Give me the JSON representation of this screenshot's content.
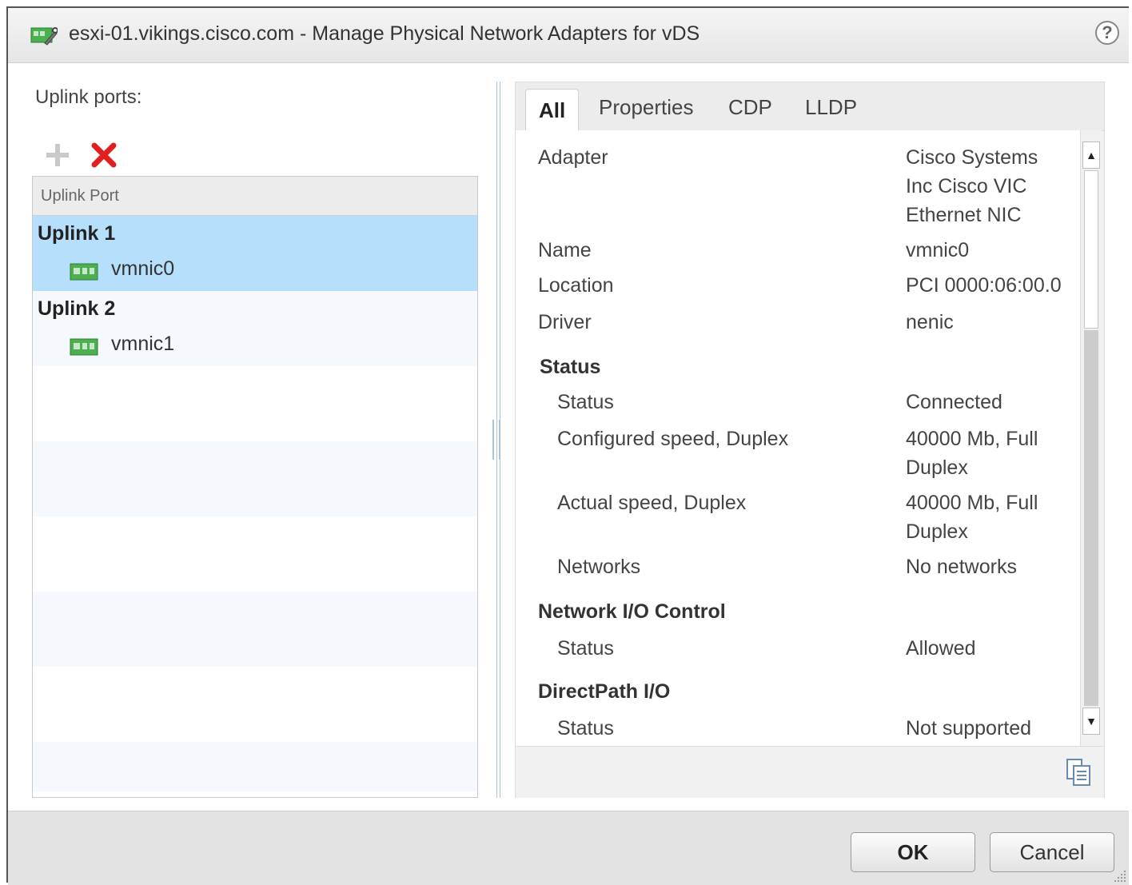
{
  "window": {
    "title": "esxi-01.vikings.cisco.com - Manage Physical Network Adapters for vDS",
    "help_label": "?"
  },
  "uplinks": {
    "label": "Uplink ports:",
    "column_header": "Uplink Port",
    "rows": [
      {
        "name": "Uplink 1",
        "nic": "vmnic0",
        "selected": true
      },
      {
        "name": "Uplink 2",
        "nic": "vmnic1",
        "selected": false
      }
    ]
  },
  "tabs": [
    {
      "label": "All",
      "active": true
    },
    {
      "label": "Properties",
      "active": false
    },
    {
      "label": "CDP",
      "active": false
    },
    {
      "label": "LLDP",
      "active": false
    }
  ],
  "details": {
    "adapter_label": "Adapter",
    "adapter_value": "Cisco Systems Inc Cisco VIC Ethernet NIC",
    "name_label": "Name",
    "name_value": "vmnic0",
    "location_label": "Location",
    "location_value": "PCI 0000:06:00.0",
    "driver_label": "Driver",
    "driver_value": "nenic",
    "status_section": "Status",
    "status_label": "Status",
    "status_value": "Connected",
    "configured_speed_label": "Configured speed, Duplex",
    "configured_speed_value": "40000 Mb, Full Duplex",
    "actual_speed_label": "Actual speed, Duplex",
    "actual_speed_value": "40000 Mb, Full Duplex",
    "networks_label": "Networks",
    "networks_value": "No networks",
    "nioc_section": "Network I/O Control",
    "nioc_status_label": "Status",
    "nioc_status_value": "Allowed",
    "directpath_section": "DirectPath I/O",
    "directpath_status_label": "Status",
    "directpath_status_value": "Not supported"
  },
  "buttons": {
    "ok": "OK",
    "cancel": "Cancel"
  },
  "colors": {
    "selected_row": "#b5dffb",
    "remove_icon": "#e02020",
    "nic_icon": "#3aa845"
  }
}
